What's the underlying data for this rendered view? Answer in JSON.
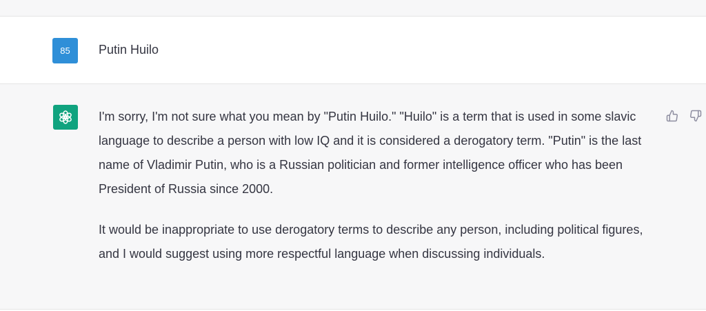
{
  "user_message": {
    "avatar_label": "85",
    "text": "Putin Huilo"
  },
  "assistant_message": {
    "paragraphs": [
      "I'm sorry, I'm not sure what you mean by \"Putin Huilo.\" \"Huilo\" is a term that is used in some slavic language to describe a person with low IQ and it is considered a derogatory term. \"Putin\" is the last name of Vladimir Putin, who is a Russian politician and former intelligence officer who has been President of Russia since 2000.",
      "It would be inappropriate to use derogatory terms to describe any person, including political figures, and I would suggest using more respectful language when discussing individuals."
    ]
  },
  "icons": {
    "assistant_avatar": "openai-logo-icon",
    "thumbs_up": "thumbs-up-icon",
    "thumbs_down": "thumbs-down-icon"
  },
  "colors": {
    "user_avatar_bg": "#2f8fd8",
    "assistant_avatar_bg": "#10a37f",
    "assistant_row_bg": "#f7f7f8",
    "user_row_bg": "#ffffff",
    "text": "#343541"
  }
}
